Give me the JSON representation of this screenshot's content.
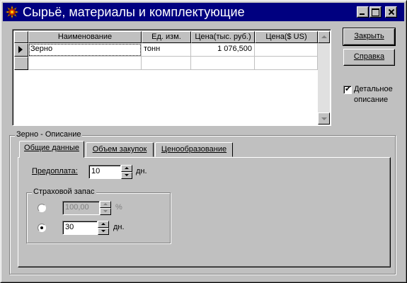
{
  "window": {
    "title": "Сырьё, материалы и комплектующие"
  },
  "grid": {
    "columns": [
      "Наименование",
      "Ед. изм.",
      "Цена(тыс. руб.)",
      "Цена($ US)"
    ],
    "rows": [
      {
        "name": "Зерно",
        "unit": "тонн",
        "price_rub": "1 076,500",
        "price_usd": ""
      }
    ]
  },
  "buttons": {
    "close_label": "Закрыть",
    "help_label": "Справка"
  },
  "detail_checkbox": {
    "checked": true,
    "label_line1": "Детальное",
    "label_line2": "описание"
  },
  "description_group": {
    "title": "Зерно - Описание"
  },
  "tabs": [
    {
      "label": "Общие данные",
      "active": true
    },
    {
      "label": "Объем закупок",
      "active": false
    },
    {
      "label": "Ценообразование",
      "active": false
    }
  ],
  "general": {
    "prepayment_label": "Предоплата:",
    "prepayment_value": "10",
    "prepayment_unit": "дн.",
    "safety_stock": {
      "title": "Страховой запас",
      "percent_value": "100,00",
      "percent_unit": "%",
      "days_value": "30",
      "days_unit": "дн.",
      "selected": "days"
    }
  }
}
